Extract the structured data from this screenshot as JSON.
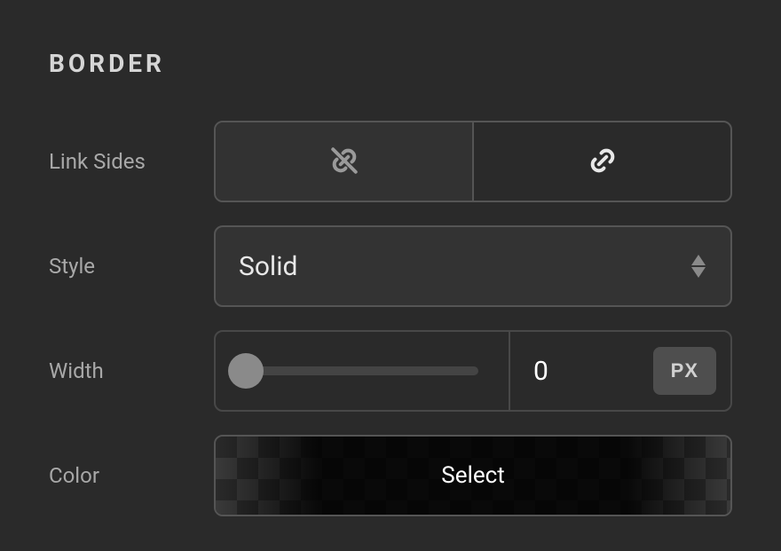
{
  "section": {
    "title": "BORDER"
  },
  "linkSides": {
    "label": "Link Sides",
    "activeIndex": 0
  },
  "style": {
    "label": "Style",
    "value": "Solid"
  },
  "width": {
    "label": "Width",
    "value": "0",
    "unit": "PX",
    "sliderPercent": 0
  },
  "color": {
    "label": "Color",
    "buttonText": "Select"
  }
}
